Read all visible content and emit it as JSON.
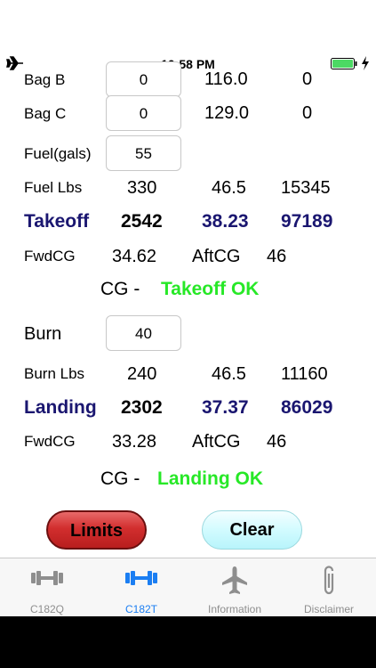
{
  "status_bar": {
    "time": "10:58 PM"
  },
  "rows": {
    "bag_b": {
      "label": "Bag B",
      "input": "0",
      "arm": "116.0",
      "moment": "0"
    },
    "bag_c": {
      "label": "Bag C",
      "input": "0",
      "arm": "129.0",
      "moment": "0"
    },
    "fuel_gals": {
      "label": "Fuel(gals)",
      "input": "55"
    },
    "fuel_lbs": {
      "label": "Fuel Lbs",
      "weight": "330",
      "arm": "46.5",
      "moment": "15345"
    },
    "takeoff": {
      "label": "Takeoff",
      "weight": "2542",
      "arm": "38.23",
      "moment": "97189"
    },
    "takeoff_cg": {
      "fwd_label": "FwdCG",
      "fwd": "34.62",
      "aft_label": "AftCG",
      "aft": "46"
    },
    "takeoff_status": {
      "prefix": "CG -",
      "status": "Takeoff OK"
    },
    "burn": {
      "label": "Burn",
      "input": "40"
    },
    "burn_lbs": {
      "label": "Burn Lbs",
      "weight": "240",
      "arm": "46.5",
      "moment": "11160"
    },
    "landing": {
      "label": "Landing",
      "weight": "2302",
      "arm": "37.37",
      "moment": "86029"
    },
    "landing_cg": {
      "fwd_label": "FwdCG",
      "fwd": "33.28",
      "aft_label": "AftCG",
      "aft": "46"
    },
    "landing_status": {
      "prefix": "CG -",
      "status": "Landing OK"
    }
  },
  "buttons": {
    "limits": "Limits",
    "clear": "Clear"
  },
  "tabs": [
    {
      "label": "C182Q",
      "icon": "dumbbell-icon",
      "active": false
    },
    {
      "label": "C182T",
      "icon": "dumbbell-icon",
      "active": true
    },
    {
      "label": "Information",
      "icon": "airplane-icon",
      "active": false
    },
    {
      "label": "Disclaimer",
      "icon": "paperclip-icon",
      "active": false
    }
  ],
  "colors": {
    "accent": "#1b7ef2",
    "ok": "#27e827",
    "heading": "#1a1670",
    "limits_button": "#d22e2e",
    "clear_button": "#d2fbff"
  }
}
